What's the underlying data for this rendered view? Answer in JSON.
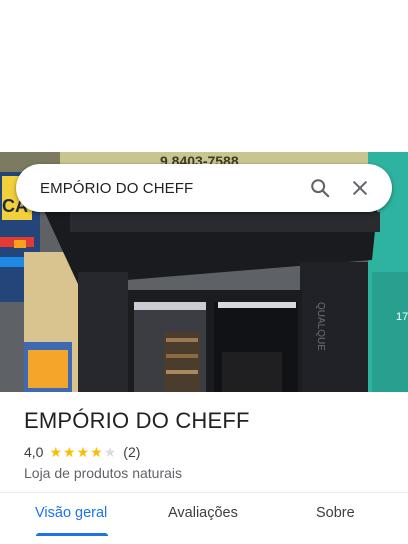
{
  "search": {
    "query": "EMPÓRIO DO CHEFF",
    "search_icon": "search-icon",
    "close_icon": "close-icon"
  },
  "photo": {
    "sign_phone": "9.8403-7588",
    "banner_text": "CA",
    "wall_text": "QUALQUE",
    "number_text": "17"
  },
  "place": {
    "title": "EMPÓRIO DO CHEFF",
    "rating": "4,0",
    "stars_filled": 4,
    "stars_total": 5,
    "review_count": "(2)",
    "category": "Loja de produtos naturais"
  },
  "tabs": [
    {
      "label": "Visão geral",
      "active": true
    },
    {
      "label": "Avaliações",
      "active": false
    },
    {
      "label": "Sobre",
      "active": false
    }
  ],
  "colors": {
    "accent": "#1a73e8",
    "star": "#fbbc04",
    "star_empty": "#dadce0"
  }
}
